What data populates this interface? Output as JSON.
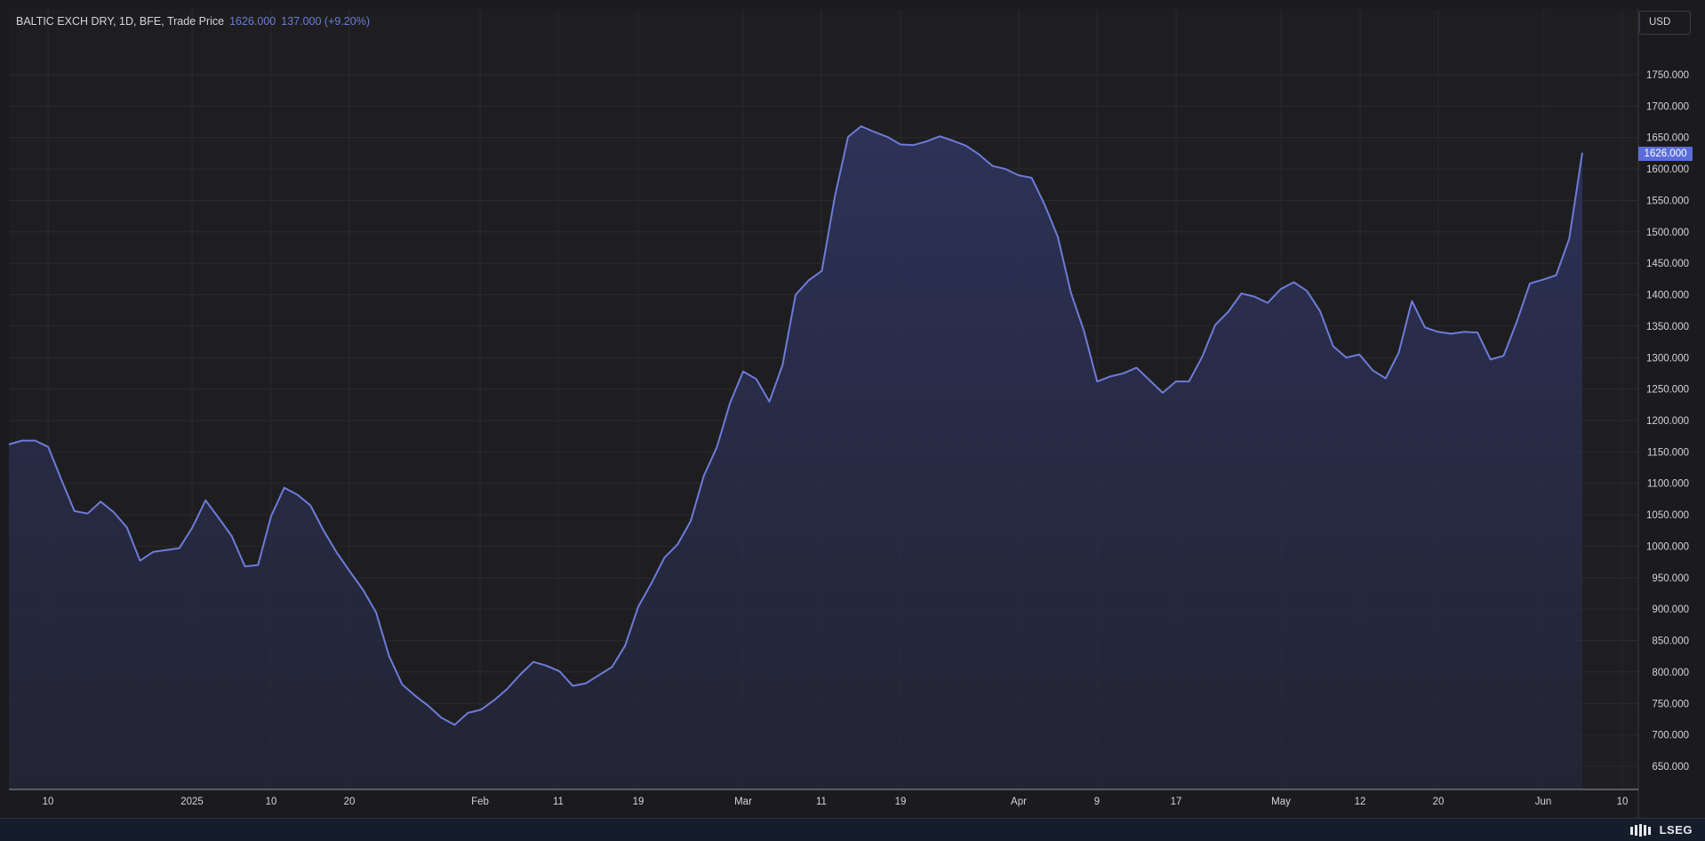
{
  "legend": {
    "symbol": "BALTIC EXCH DRY, 1D, BFE, Trade Price",
    "last": "1626.000",
    "change": "137.000 (+9.20%)"
  },
  "currency": "USD",
  "last_badge": "1626.000",
  "brand": "LSEG",
  "colors": {
    "line": "#6d7bd8",
    "area_top": "#2e335a",
    "badge": "#5b6ddb",
    "background": "#1e1e20",
    "grid": "#2b2b2e"
  },
  "chart_data": {
    "type": "area",
    "series": [
      {
        "values": [
          1162,
          1168,
          1168,
          1158,
          1106,
          1056,
          1052,
          1071,
          1054,
          1030,
          977,
          991,
          994,
          997,
          1030,
          1073,
          1045,
          1016,
          968,
          970,
          1048,
          1093,
          1082,
          1065,
          1025,
          990,
          960,
          931,
          895,
          825,
          780,
          762,
          746,
          727,
          716,
          735,
          740,
          755,
          773,
          796,
          816,
          810,
          801,
          778,
          782,
          795,
          808,
          842,
          904,
          941,
          982,
          1003,
          1040,
          1112,
          1158,
          1228,
          1278,
          1266,
          1230,
          1288,
          1400,
          1423,
          1438,
          1557,
          1651,
          1668,
          1659,
          1651,
          1639,
          1638,
          1644,
          1652,
          1645,
          1637,
          1623,
          1605,
          1600,
          1590,
          1586,
          1543,
          1492,
          1403,
          1342,
          1262,
          1270,
          1275,
          1284,
          1264,
          1244,
          1262,
          1262,
          1301,
          1352,
          1373,
          1402,
          1397,
          1387,
          1409,
          1420,
          1406,
          1374,
          1318,
          1300,
          1305,
          1280,
          1267,
          1308,
          1390,
          1348,
          1341,
          1338,
          1341,
          1340,
          1297,
          1303,
          1357,
          1418,
          1424,
          1431,
          1489,
          1626
        ]
      }
    ],
    "ylim": [
      600,
      1800
    ],
    "y_ticks": [
      "650.000",
      "700.000",
      "750.000",
      "800.000",
      "850.000",
      "900.000",
      "950.000",
      "1000.000",
      "1050.000",
      "1100.000",
      "1150.000",
      "1200.000",
      "1250.000",
      "1300.000",
      "1350.000",
      "1400.000",
      "1450.000",
      "1500.000",
      "1550.000",
      "1600.000",
      "1650.000",
      "1700.000",
      "1750.000"
    ],
    "x_ticks": [
      "10",
      "2025",
      "10",
      "20",
      "Feb",
      "11",
      "19",
      "Mar",
      "11",
      "19",
      "Apr",
      "9",
      "17",
      "May",
      "12",
      "20",
      "Jun",
      "10"
    ],
    "grid": true,
    "legend_position": "top-left"
  }
}
